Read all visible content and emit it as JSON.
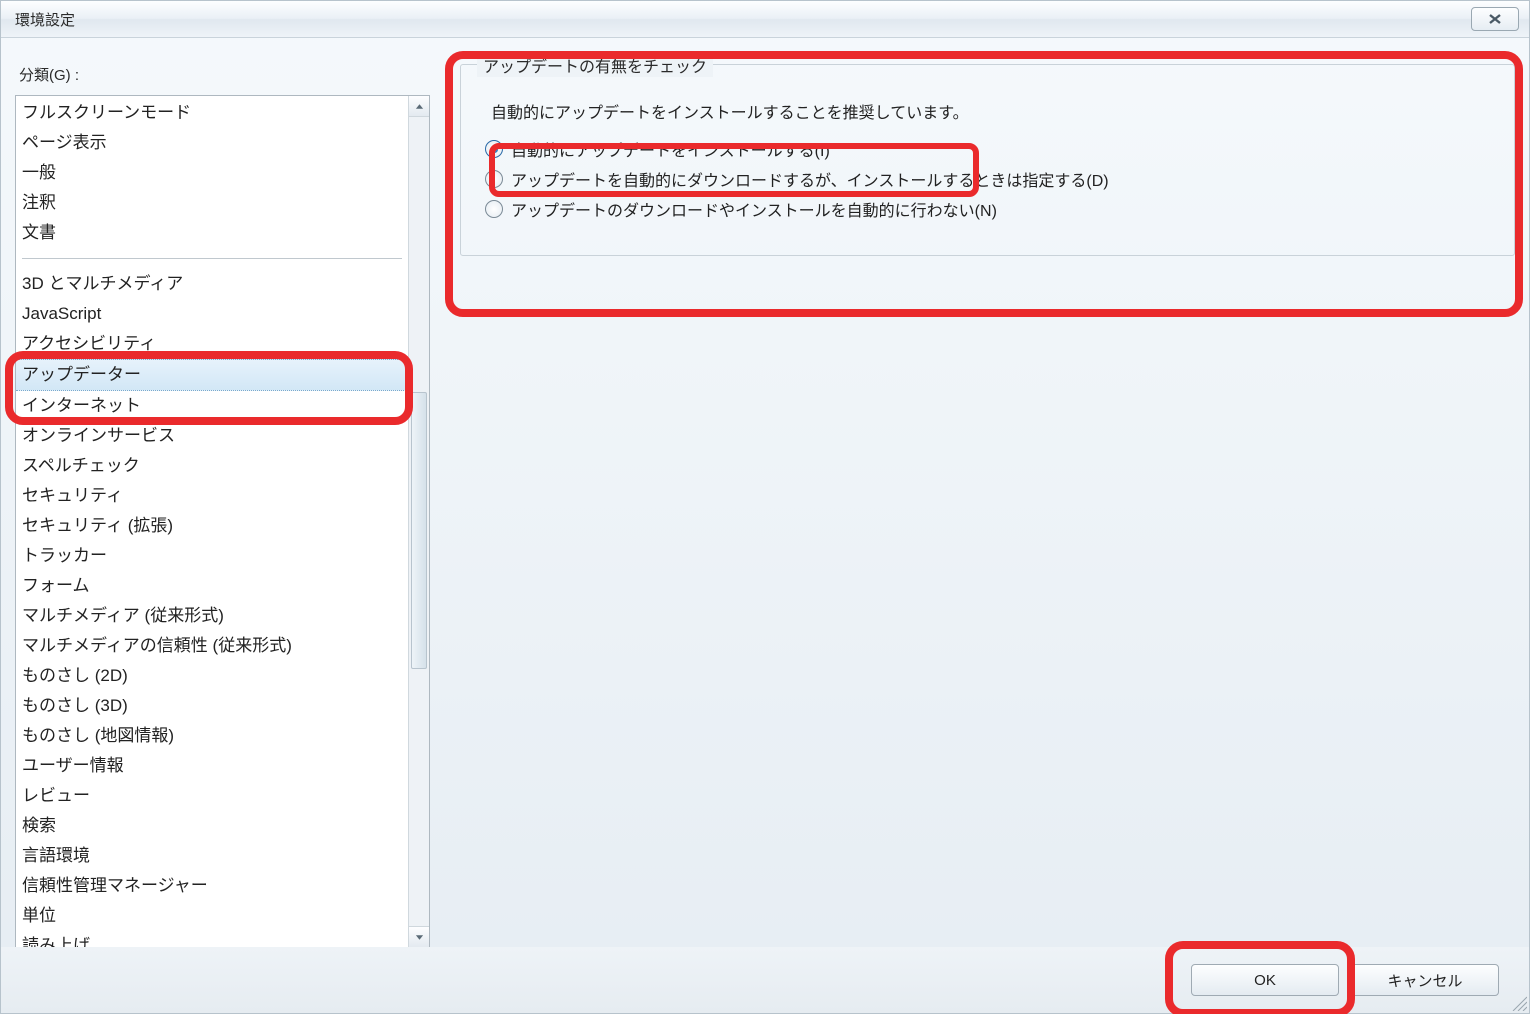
{
  "window": {
    "title": "環境設定"
  },
  "sidebar": {
    "label": "分類(G) :",
    "items": [
      "フルスクリーンモード",
      "ページ表示",
      "一般",
      "注釈",
      "文書"
    ],
    "items2": [
      "3D とマルチメディア",
      "JavaScript",
      "アクセシビリティ",
      "アップデーター",
      "インターネット",
      "オンラインサービス",
      "スペルチェック",
      "セキュリティ",
      "セキュリティ (拡張)",
      "トラッカー",
      "フォーム",
      "マルチメディア (従来形式)",
      "マルチメディアの信頼性 (従来形式)",
      "ものさし (2D)",
      "ものさし (3D)",
      "ものさし (地図情報)",
      "ユーザー情報",
      "レビュー",
      "検索",
      "言語環境",
      "信頼性管理マネージャー",
      "単位",
      "読み上げ"
    ],
    "selected_index": 3
  },
  "panel": {
    "legend": "アップデートの有無をチェック",
    "description": "自動的にアップデートをインストールすることを推奨しています。",
    "options": [
      "自動的にアップデートをインストールする(I)",
      "アップデートを自動的にダウンロードするが、インストールするときは指定する(D)",
      "アップデートのダウンロードやインストールを自動的に行わない(N)"
    ],
    "selected_option": 0
  },
  "buttons": {
    "ok": "OK",
    "cancel": "キャンセル"
  }
}
